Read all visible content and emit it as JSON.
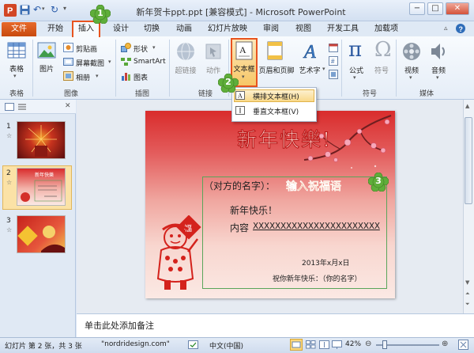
{
  "window": {
    "title": "新年贺卡ppt.ppt [兼容模式] - Microsoft PowerPoint",
    "controls": {
      "minimize": "−",
      "maximize": "□",
      "close": "✕"
    }
  },
  "tabs": {
    "file": "文件",
    "items": [
      "开始",
      "插入",
      "设计",
      "切换",
      "动画",
      "幻灯片放映",
      "审阅",
      "视图",
      "开发工具",
      "加载项"
    ]
  },
  "ribbon": {
    "table": "表格",
    "picture": "图片",
    "clipart": "剪贴画",
    "screenshot": "屏幕截图",
    "album": "相册",
    "shapes": "形状",
    "smartart": "SmartArt",
    "chart": "图表",
    "hyperlink": "超链接",
    "action": "动作",
    "textbox_line1": "文本框",
    "header_footer": "页眉和页脚",
    "wordart": "艺术字",
    "equation": "公式",
    "symbol": "符号",
    "video": "视频",
    "audio": "音频",
    "groups": {
      "table": "表格",
      "images": "图像",
      "illustrations": "插图",
      "links": "链接",
      "symbols": "符号",
      "media": "媒体"
    }
  },
  "dropdown": {
    "horizontal": "横排文本框(H)",
    "vertical": "垂直文本框(V)"
  },
  "slide_pane": {
    "numbers": [
      "1",
      "2",
      "3"
    ]
  },
  "slide": {
    "title": "新年快樂!",
    "recipient": "（对方的名字）：",
    "callout_text": "输入祝福语",
    "greeting": "新年快乐！",
    "content_label": "内容",
    "content_value": "XXXXXXXXXXXXXXXXXXXXXXX",
    "date": "2013年x月x日",
    "signature": "祝你新年快乐：（你的名字）"
  },
  "callouts": [
    "1",
    "2",
    "3"
  ],
  "notes": {
    "placeholder": "单击此处添加备注"
  },
  "status": {
    "slide_info": "幻灯片 第 2 张，共 3 张",
    "theme": "\"nordridesign.com\"",
    "language": "中文(中国)",
    "zoom": "42%"
  },
  "colors": {
    "accent_orange": "#e8531e",
    "ribbon_bg": "#e5edf7",
    "slide_red": "#d92c2c",
    "callout_green": "#5fae3a"
  }
}
